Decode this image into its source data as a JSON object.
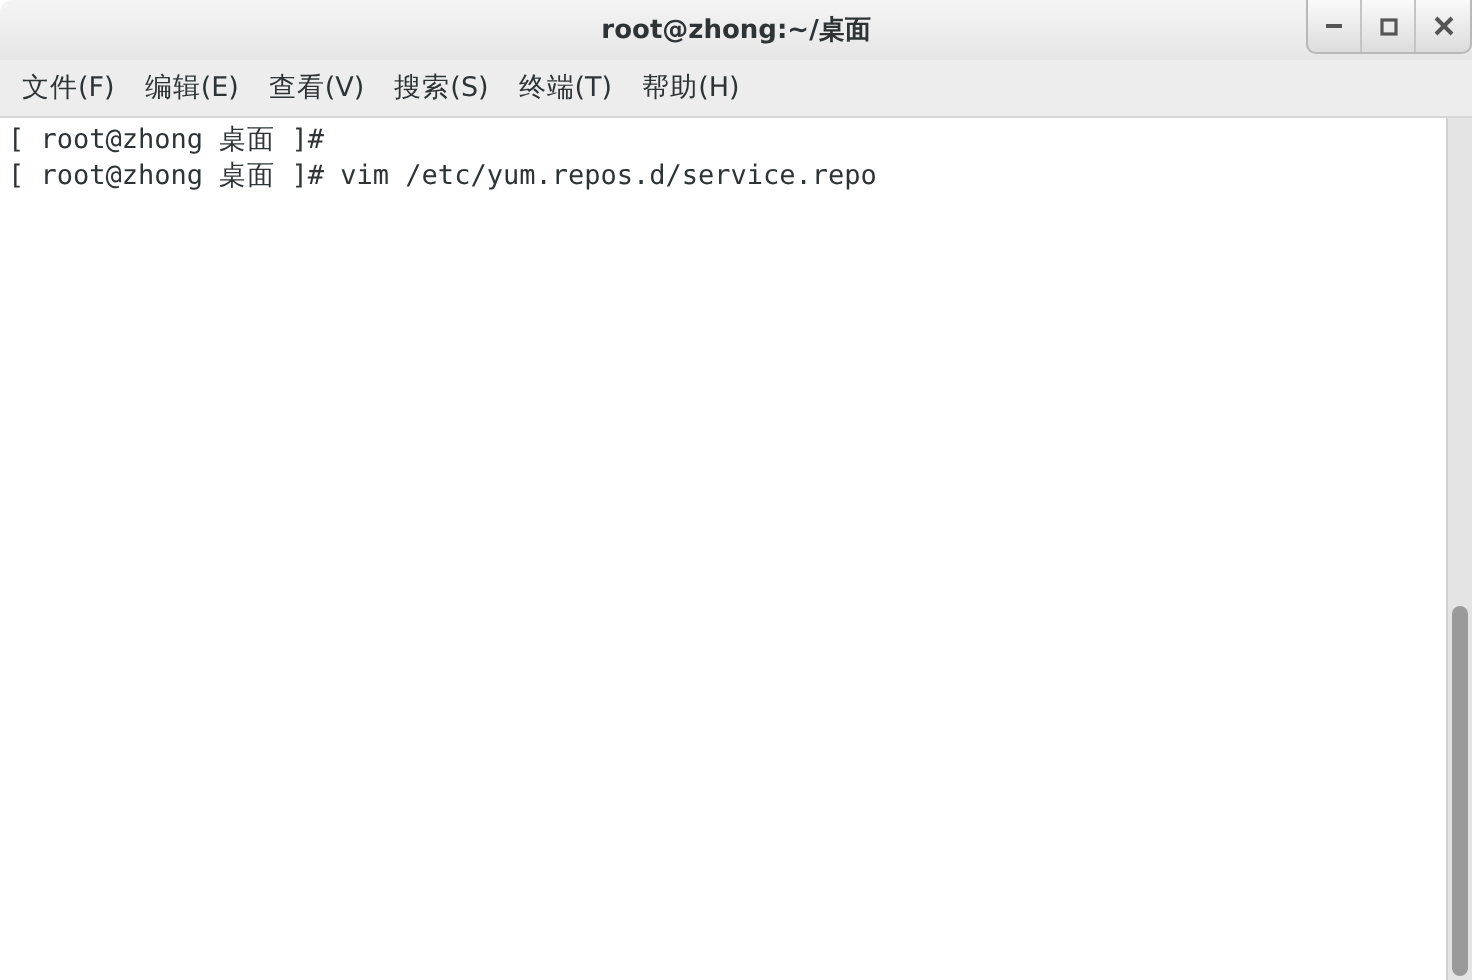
{
  "window": {
    "title": "root@zhong:~/桌面"
  },
  "menu": [
    "文件(F)",
    "编辑(E)",
    "查看(V)",
    "搜索(S)",
    "终端(T)",
    "帮助(H)"
  ],
  "terminal": {
    "lines": [
      "[ root@zhong 桌面 ]# ",
      "[ root@zhong 桌面 ]# vim /etc/yum.repos.d/service.repo"
    ]
  }
}
